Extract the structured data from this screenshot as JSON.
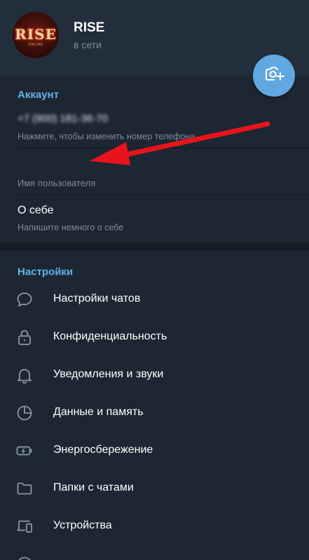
{
  "profile": {
    "avatar_text": "RISE",
    "avatar_subtext": "ONLINE",
    "name": "RISE",
    "status": "в сети"
  },
  "account": {
    "section_title": "Аккаунт",
    "phone_number": "+7 (900) 181-36-70",
    "phone_hint": "Нажмите, чтобы изменить номер телефона",
    "username_label": "Имя пользователя",
    "bio_title": "О себе",
    "bio_hint": "Напишите немного о себе"
  },
  "settings": {
    "section_title": "Настройки",
    "items": [
      {
        "label": "Настройки чатов",
        "icon": "chat-bubble-icon"
      },
      {
        "label": "Конфиденциальность",
        "icon": "lock-icon"
      },
      {
        "label": "Уведомления и звуки",
        "icon": "bell-icon"
      },
      {
        "label": "Данные и память",
        "icon": "pie-chart-icon"
      },
      {
        "label": "Энергосбережение",
        "icon": "battery-icon"
      },
      {
        "label": "Папки с чатами",
        "icon": "folder-icon"
      },
      {
        "label": "Устройства",
        "icon": "devices-icon"
      }
    ]
  },
  "colors": {
    "accent": "#64b0ea",
    "camera_button": "#62a8e0",
    "background": "#1d2733",
    "header": "#232e3c",
    "annotation_arrow": "#e8141b"
  }
}
